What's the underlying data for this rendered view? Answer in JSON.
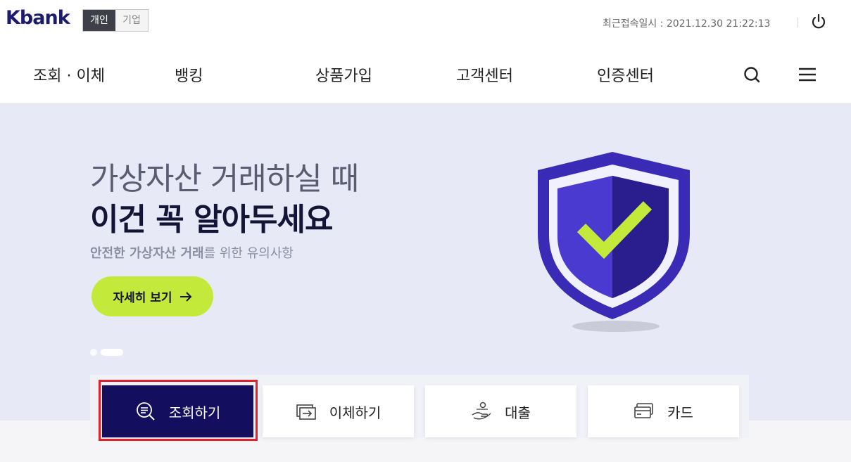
{
  "header": {
    "logo": "Kbank",
    "segments": [
      "개인",
      "기업"
    ],
    "selected_segment": "개인",
    "last_login": "최근접속일시 : 2021.12.30 21:22:13"
  },
  "nav": {
    "items": [
      "조회 · 이체",
      "뱅킹",
      "상품가입",
      "고객센터",
      "인증센터"
    ]
  },
  "hero": {
    "title": "가상자산 거래하실 때",
    "headline": "이건 꼭 알아두세요",
    "subtitle_bold": "안전한 가상자산 거래",
    "subtitle_rest": "를 위한 유의사항",
    "cta": "자세히 보기",
    "slides_count": 2,
    "active_slide": 2
  },
  "quick_menu": {
    "items": [
      "조회하기",
      "이체하기",
      "대출",
      "카드"
    ],
    "selected": "조회하기"
  },
  "colors": {
    "brand": "#1d1c6b",
    "accent_green": "#c3e93b",
    "hero_bg": "#e7eaf6",
    "quick_active": "#140e5e",
    "focus_outline": "#e0202c"
  }
}
